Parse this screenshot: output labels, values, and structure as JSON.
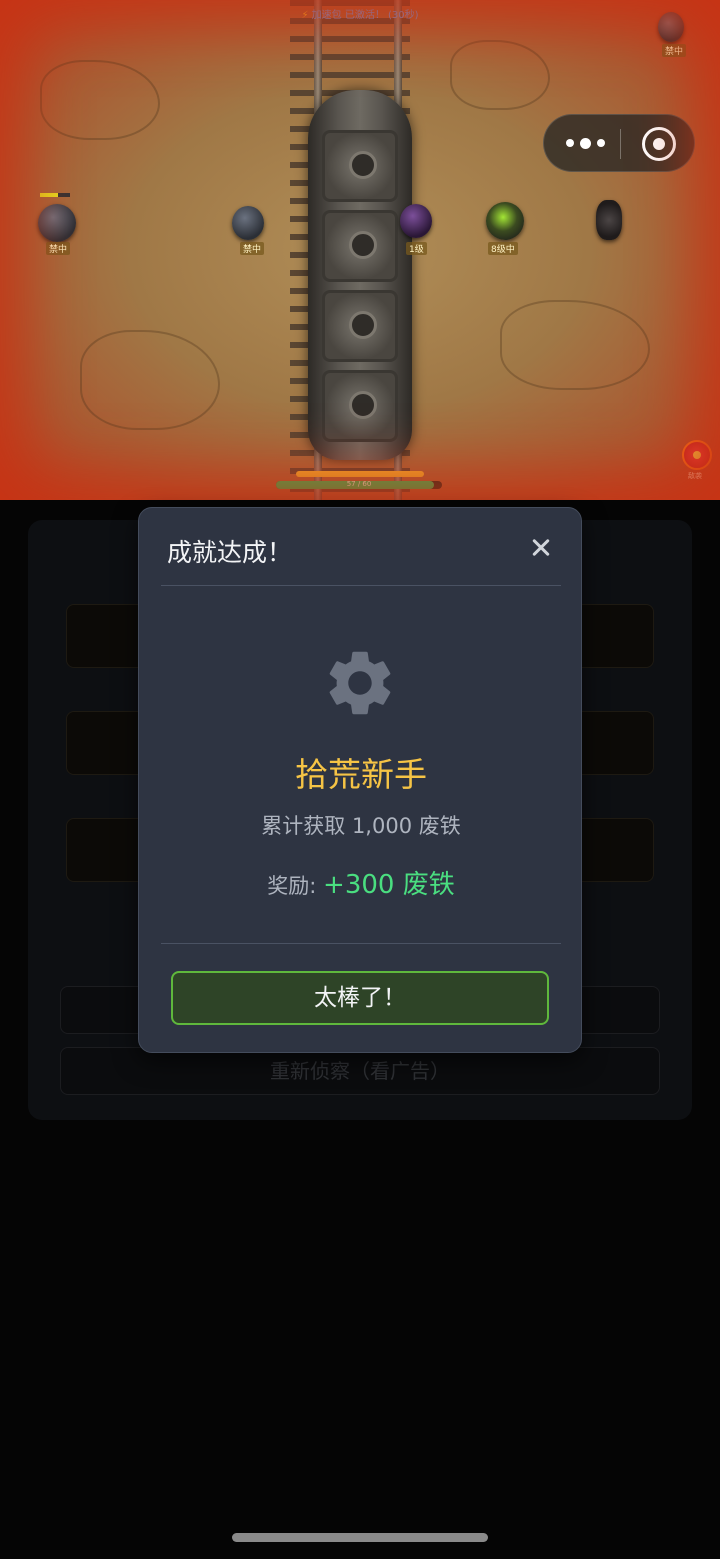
{
  "game": {
    "boost_status": "加速包 已激活！ (30秒)",
    "enemy_tags": [
      "禁中",
      "禁中",
      "禁中",
      "1级",
      "8级中",
      "禁中"
    ],
    "progress_bar_label": "57 / 60",
    "progress_value": 57,
    "progress_max": 60,
    "alert_label": "敌袭"
  },
  "background": {
    "ad_button_label": "重新侦察（看广告）"
  },
  "modal": {
    "title": "成就达成！",
    "achievement_name": "拾荒新手",
    "achievement_desc": "累计获取 1,000 废铁",
    "reward_label": "奖励:",
    "reward_value": "+300 废铁",
    "confirm_button": "太棒了！",
    "colors": {
      "title_gold": "#f6c445",
      "reward_green": "#4ade80",
      "button_border": "#5fb83c"
    }
  }
}
